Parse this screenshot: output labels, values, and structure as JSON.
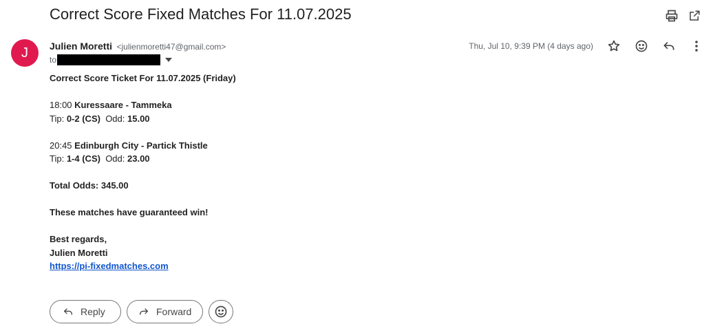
{
  "email": {
    "subject": "Correct Score Fixed Matches For 11.07.2025",
    "sender": {
      "avatar_letter": "J",
      "avatar_color": "#e01a4f",
      "name": "Julien Moretti",
      "email": "<julienmoretti47@gmail.com>"
    },
    "to_label": "to",
    "date": "Thu, Jul 10, 9:39 PM (4 days ago)",
    "body": {
      "heading": "Correct Score Ticket For 11.07.2025 (Friday)",
      "match1": {
        "time": "18:00",
        "teams": "Kuressaare - Tammeka",
        "tip_label": "Tip:",
        "tip": "0-2 (CS)",
        "odd_label": "Odd:",
        "odd": "15.00"
      },
      "match2": {
        "time": "20:45",
        "teams": "Edinburgh City - Partick Thistle",
        "tip_label": "Tip:",
        "tip": "1-4 (CS)",
        "odd_label": "Odd:",
        "odd": "23.00"
      },
      "total": "Total Odds: 345.00",
      "claim": "These matches have guaranteed win!",
      "regards": "Best regards,",
      "signature": "Julien Moretti",
      "link": "https://pi-fixedmatches.com"
    }
  },
  "actions": {
    "reply_label": "Reply",
    "forward_label": "Forward"
  },
  "icons": {
    "print": "print-icon",
    "open_new_window": "open-in-new-window-icon",
    "star": "star-icon",
    "emoji": "emoji-icon",
    "reply": "reply-icon",
    "more": "more-vert-icon"
  }
}
